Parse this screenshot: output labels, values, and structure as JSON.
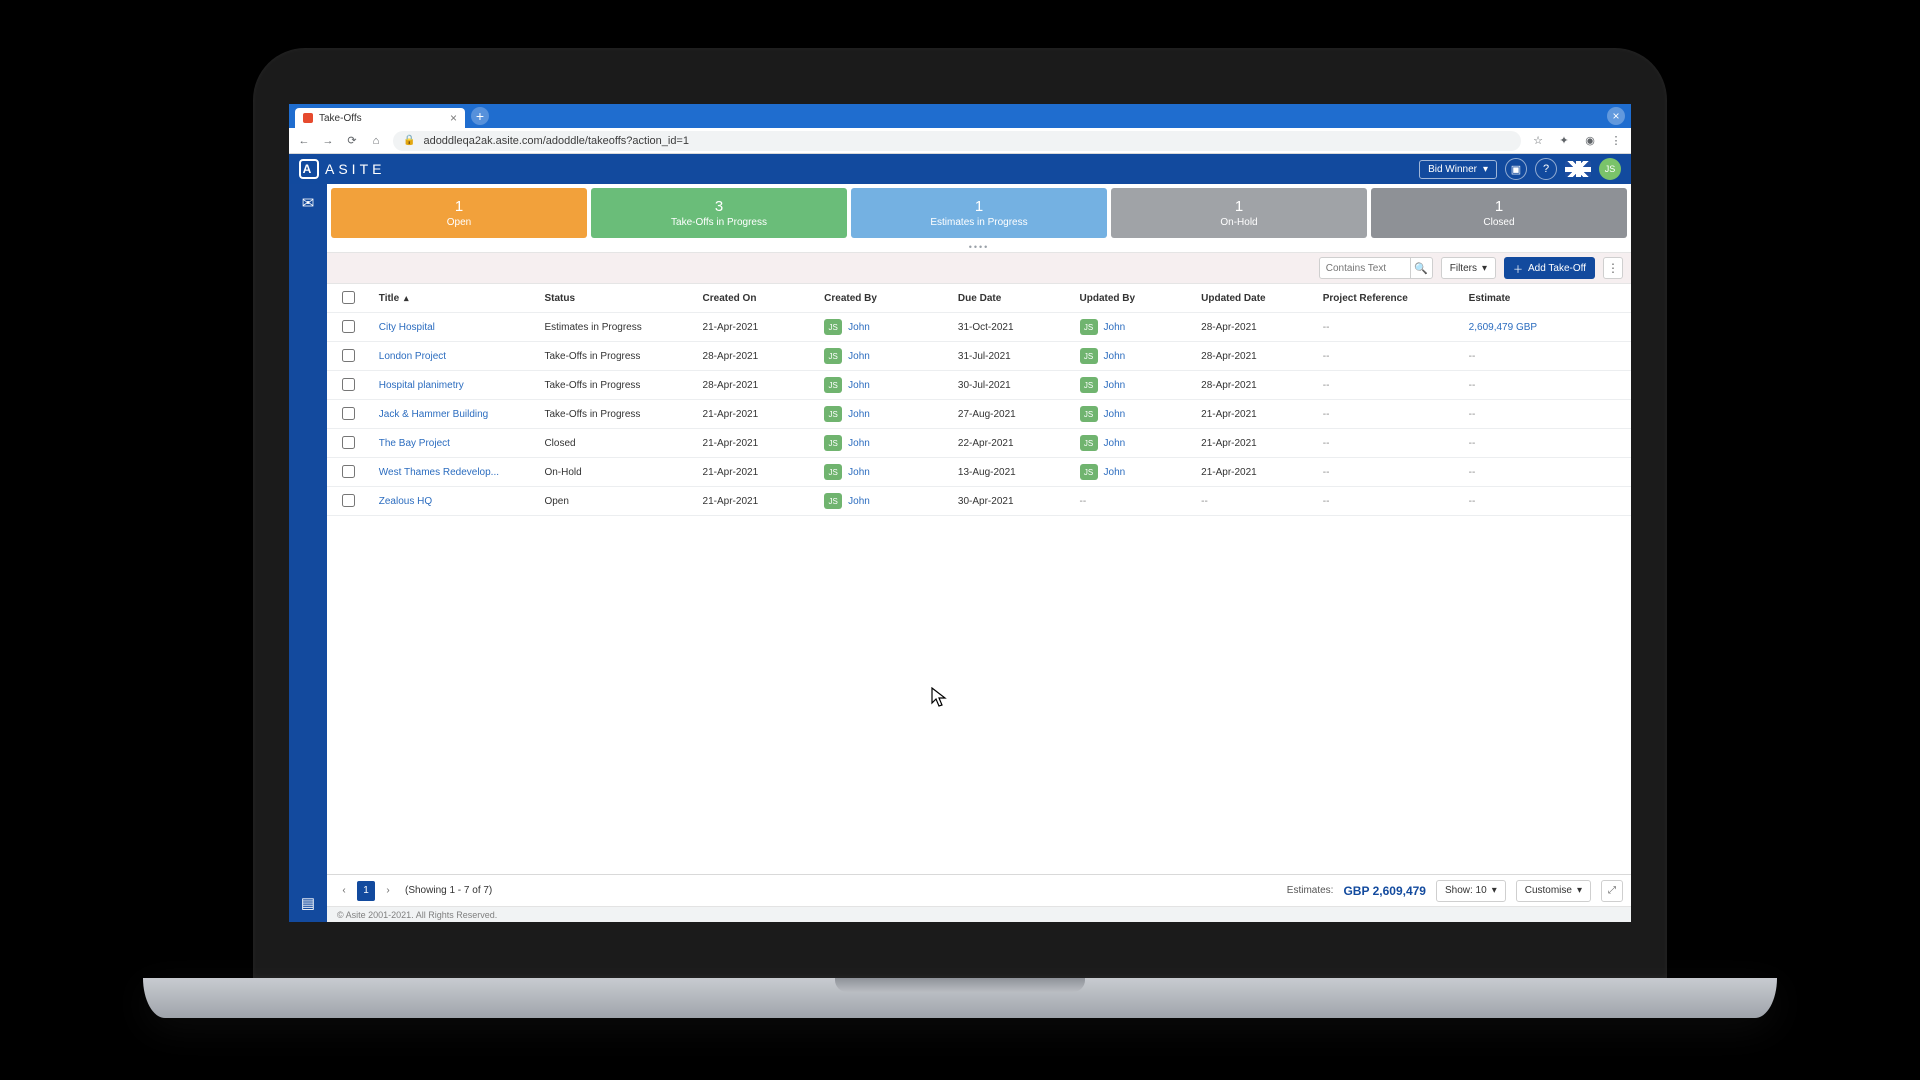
{
  "browser": {
    "tab_title": "Take-Offs",
    "url": "adoddleqa2ak.asite.com/adoddle/takeoffs?action_id=1"
  },
  "header": {
    "brand": "ASITE",
    "role_dropdown": "Bid Winner",
    "avatar_initials": "JS"
  },
  "status_cards": [
    {
      "count": "1",
      "label": "Open",
      "color": "c-orange"
    },
    {
      "count": "3",
      "label": "Take-Offs in Progress",
      "color": "c-green"
    },
    {
      "count": "1",
      "label": "Estimates in Progress",
      "color": "c-blue"
    },
    {
      "count": "1",
      "label": "On-Hold",
      "color": "c-grey1"
    },
    {
      "count": "1",
      "label": "Closed",
      "color": "c-grey2"
    }
  ],
  "toolbar": {
    "search_placeholder": "Contains Text",
    "filters_label": "Filters",
    "add_label": "Add Take-Off"
  },
  "columns": {
    "title": "Title",
    "status": "Status",
    "created_on": "Created On",
    "created_by": "Created By",
    "due_date": "Due Date",
    "updated_by": "Updated By",
    "updated_date": "Updated Date",
    "project_reference": "Project Reference",
    "estimate": "Estimate"
  },
  "rows": [
    {
      "title": "City Hospital",
      "status": "Estimates in Progress",
      "created_on": "21-Apr-2021",
      "created_by": "John",
      "due_date": "31-Oct-2021",
      "updated_by": "John",
      "updated_date": "28-Apr-2021",
      "project_reference": "--",
      "estimate": "2,609,479 GBP"
    },
    {
      "title": "London Project",
      "status": "Take-Offs in Progress",
      "created_on": "28-Apr-2021",
      "created_by": "John",
      "due_date": "31-Jul-2021",
      "updated_by": "John",
      "updated_date": "28-Apr-2021",
      "project_reference": "--",
      "estimate": "--"
    },
    {
      "title": "Hospital planimetry",
      "status": "Take-Offs in Progress",
      "created_on": "28-Apr-2021",
      "created_by": "John",
      "due_date": "30-Jul-2021",
      "updated_by": "John",
      "updated_date": "28-Apr-2021",
      "project_reference": "--",
      "estimate": "--"
    },
    {
      "title": "Jack & Hammer Building",
      "status": "Take-Offs in Progress",
      "created_on": "21-Apr-2021",
      "created_by": "John",
      "due_date": "27-Aug-2021",
      "updated_by": "John",
      "updated_date": "21-Apr-2021",
      "project_reference": "--",
      "estimate": "--"
    },
    {
      "title": "The Bay Project",
      "status": "Closed",
      "created_on": "21-Apr-2021",
      "created_by": "John",
      "due_date": "22-Apr-2021",
      "updated_by": "John",
      "updated_date": "21-Apr-2021",
      "project_reference": "--",
      "estimate": "--"
    },
    {
      "title": "West Thames Redevelop...",
      "status": "On-Hold",
      "created_on": "21-Apr-2021",
      "created_by": "John",
      "due_date": "13-Aug-2021",
      "updated_by": "John",
      "updated_date": "21-Apr-2021",
      "project_reference": "--",
      "estimate": "--"
    },
    {
      "title": "Zealous HQ",
      "status": "Open",
      "created_on": "21-Apr-2021",
      "created_by": "John",
      "due_date": "30-Apr-2021",
      "updated_by": "--",
      "updated_date": "--",
      "project_reference": "--",
      "estimate": "--"
    }
  ],
  "user_badge_initials": "JS",
  "footer": {
    "page": "1",
    "showing_text": "(Showing 1 - 7 of 7)",
    "estimates_label": "Estimates:",
    "estimates_value": "GBP 2,609,479",
    "show_label": "Show: 10",
    "customise_label": "Customise"
  },
  "copyright": "© Asite 2001-2021. All Rights Reserved."
}
